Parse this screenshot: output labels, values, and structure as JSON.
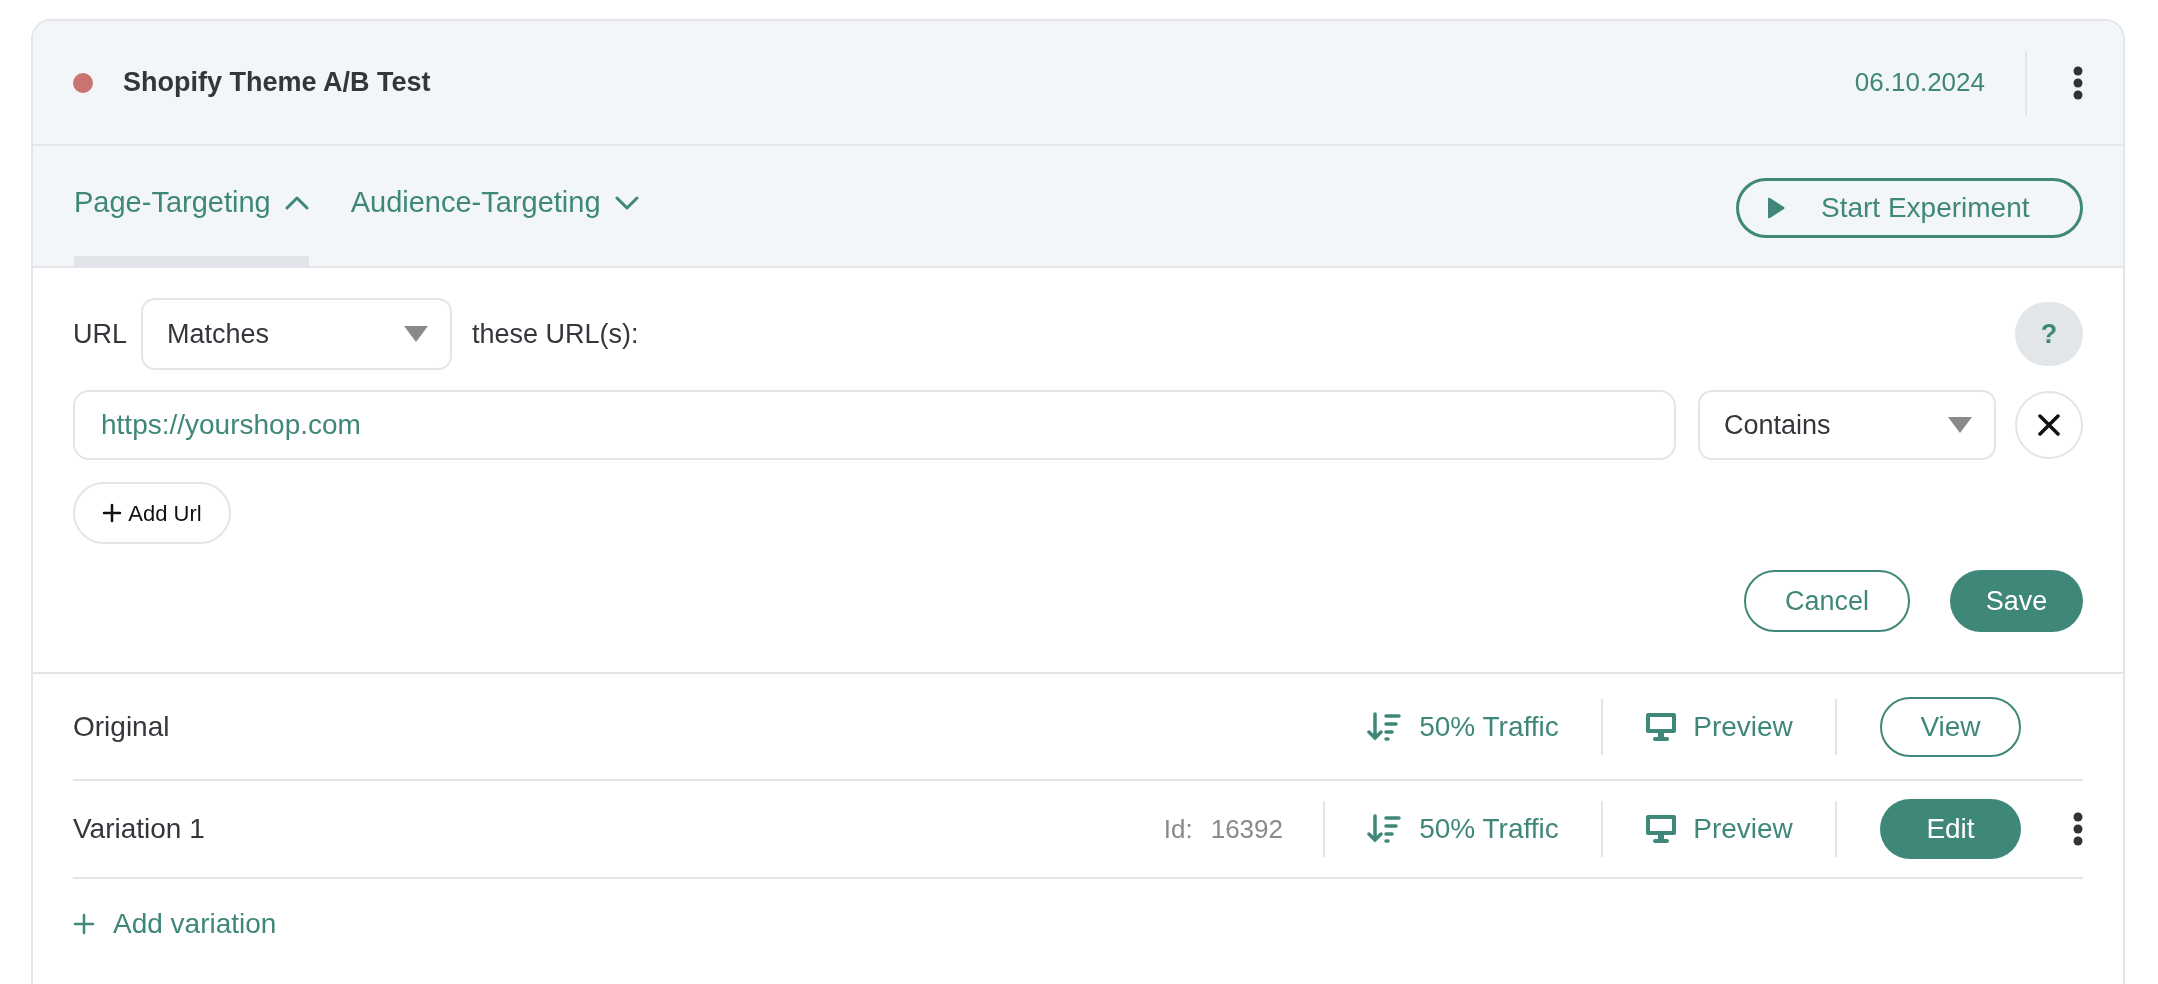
{
  "experiment": {
    "color": "#c97470",
    "title": "Shopify Theme A/B Test",
    "date": "06.10.2024"
  },
  "tabs": [
    {
      "label": "Page-Targeting",
      "selected": true
    },
    {
      "label": "Audience-Targeting",
      "selected": false
    }
  ],
  "start_button": "Start Experiment",
  "targeting": {
    "label": "URL",
    "match_select": "Matches",
    "suffix": "these URL(s):",
    "help": "?",
    "urls": [
      {
        "value": "https://yourshop.com",
        "operator": "Contains"
      }
    ],
    "add_url": "Add Url",
    "cancel": "Cancel",
    "save": "Save"
  },
  "variations": [
    {
      "name": "Original",
      "traffic": "50% Traffic",
      "preview": "Preview",
      "action": {
        "label": "View",
        "kind": "outline"
      },
      "menu": false
    },
    {
      "name": "Variation 1",
      "id_label": "Id:",
      "id": "16392",
      "traffic": "50% Traffic",
      "preview": "Preview",
      "action": {
        "label": "Edit",
        "kind": "filled"
      },
      "menu": true
    }
  ],
  "add_variation": "Add variation"
}
